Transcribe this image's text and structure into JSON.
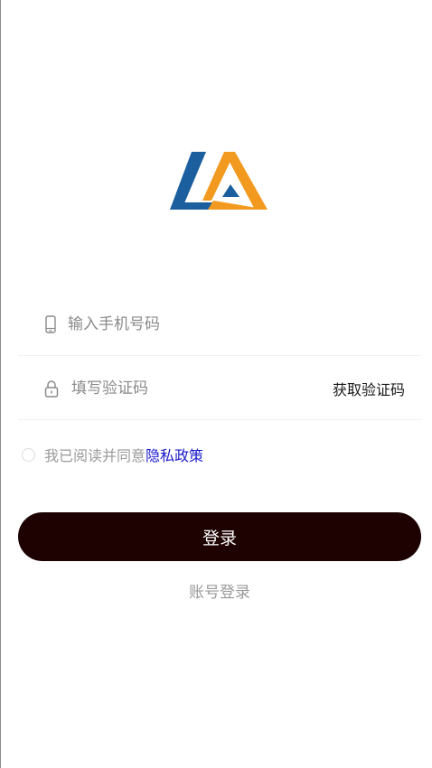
{
  "form": {
    "phone_placeholder": "输入手机号码",
    "code_placeholder": "填写验证码",
    "get_code_label": "获取验证码"
  },
  "agreement": {
    "text": "我已阅读并同意",
    "privacy_label": "隐私政策"
  },
  "actions": {
    "login_label": "登录",
    "account_login_label": "账号登录"
  },
  "icons": {
    "logo": "brand-logo-icon",
    "phone": "phone-icon",
    "lock": "lock-icon"
  },
  "colors": {
    "logo_blue": "#1b5f9e",
    "logo_orange": "#f29a1f",
    "button_bg": "#1e0202",
    "link": "#1a1acc"
  }
}
